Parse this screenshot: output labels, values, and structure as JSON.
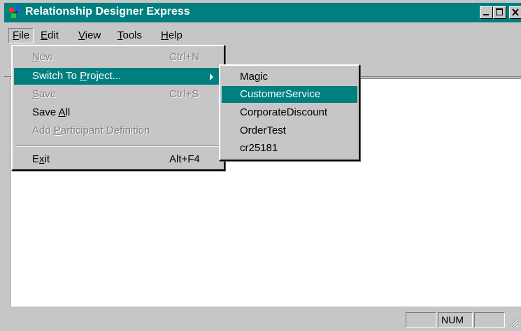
{
  "window": {
    "title": "Relationship Designer Express",
    "icon": "app-icon",
    "buttons": {
      "minimize": "minimize-icon",
      "maximize": "maximize-icon",
      "close": "close-icon"
    }
  },
  "menubar": {
    "items": [
      {
        "label": "File",
        "key": "F",
        "rest": "ile"
      },
      {
        "label": "Edit",
        "key": "E",
        "rest": "dit"
      },
      {
        "label": "View",
        "key": "V",
        "rest": "iew"
      },
      {
        "label": "Tools",
        "key": "T",
        "rest": "ools"
      },
      {
        "label": "Help",
        "key": "H",
        "rest": "elp"
      }
    ]
  },
  "file_menu": {
    "items": [
      {
        "label": "New",
        "key": "N",
        "rest": "ew",
        "accel": "Ctrl+N",
        "enabled": false
      },
      {
        "label": "Switch To Project...",
        "pre": "Switch To ",
        "key": "P",
        "rest": "roject...",
        "accel": "",
        "enabled": true,
        "highlighted": true,
        "submenu": true
      },
      {
        "label": "Save",
        "key": "S",
        "rest": "ave",
        "accel": "Ctrl+S",
        "enabled": false
      },
      {
        "label": "Save All",
        "pre": "Save ",
        "key": "A",
        "rest": "ll",
        "accel": "",
        "enabled": true
      },
      {
        "label": "Add Participant Definition",
        "pre": "Add ",
        "key": "P",
        "rest": "articipant Definition",
        "accel": "",
        "enabled": false
      },
      {
        "label": "Exit",
        "pre": "E",
        "key": "x",
        "rest": "it",
        "accel": "Alt+F4",
        "enabled": true
      }
    ]
  },
  "project_submenu": {
    "items": [
      {
        "label": "Magic",
        "highlighted": false
      },
      {
        "label": "CustomerService",
        "highlighted": true
      },
      {
        "label": "CorporateDiscount",
        "highlighted": false
      },
      {
        "label": "OrderTest",
        "highlighted": false
      },
      {
        "label": "cr25181",
        "highlighted": false
      }
    ]
  },
  "statusbar": {
    "panels": [
      "",
      "NUM",
      ""
    ]
  },
  "colors": {
    "titlebar": "#007f7f",
    "highlight": "#007f7f",
    "face": "#c6c6c6"
  }
}
